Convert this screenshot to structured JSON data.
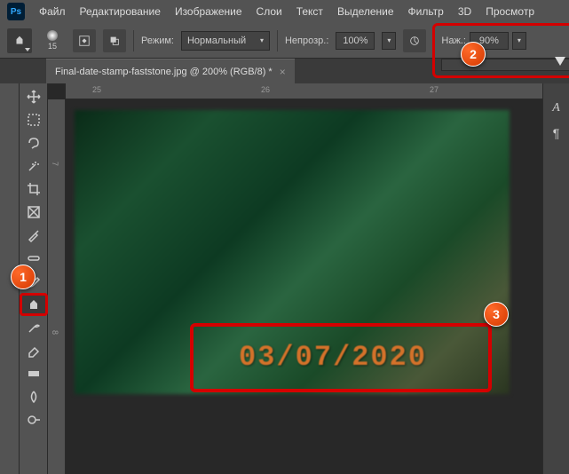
{
  "menu": {
    "file": "Файл",
    "edit": "Редактирование",
    "image": "Изображение",
    "layer": "Слои",
    "type": "Текст",
    "select": "Выделение",
    "filter": "Фильтр",
    "3d": "3D",
    "view": "Просмотр"
  },
  "options": {
    "brush_size": "15",
    "mode_label": "Режим:",
    "mode_value": "Нормальный",
    "opacity_label": "Непрозр.:",
    "opacity_value": "100%",
    "flow_label": "Наж.:",
    "flow_value": "90%"
  },
  "tab": {
    "title": "Final-date-stamp-faststone.jpg @ 200% (RGB/8) *"
  },
  "ruler": {
    "h": [
      "25",
      "26",
      "27"
    ],
    "v": [
      "7",
      "8"
    ]
  },
  "stamp": {
    "text": "03/07/2020"
  },
  "callouts": {
    "c1": "1",
    "c2": "2",
    "c3": "3"
  },
  "panel": {
    "char": "A",
    "para": "¶"
  }
}
